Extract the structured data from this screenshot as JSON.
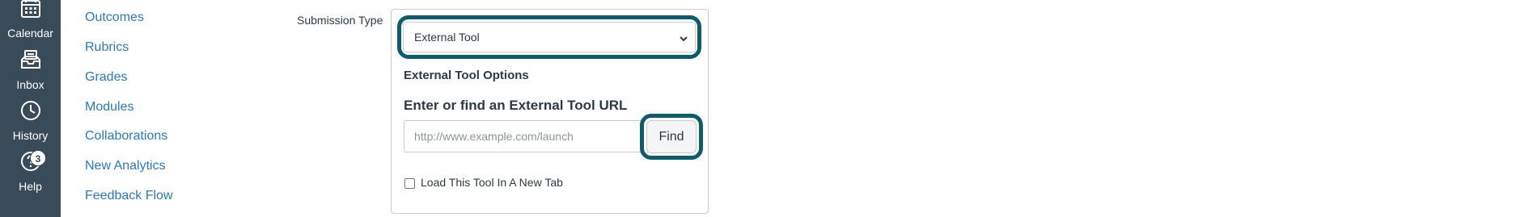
{
  "global_nav": {
    "items": [
      {
        "label": "Calendar",
        "icon": "calendar-icon"
      },
      {
        "label": "Inbox",
        "icon": "inbox-icon"
      },
      {
        "label": "History",
        "icon": "clock-icon"
      },
      {
        "label": "Help",
        "icon": "help-icon",
        "badge": "3"
      }
    ],
    "background": "#394b58"
  },
  "course_nav": {
    "items": [
      "Outcomes",
      "Rubrics",
      "Grades",
      "Modules",
      "Collaborations",
      "New Analytics",
      "Feedback Flow"
    ],
    "link_color": "#2b7abc"
  },
  "form": {
    "submission_type_label": "Submission Type",
    "submission_type_value": "External Tool",
    "external_tool_options_title": "External Tool Options",
    "url_label": "Enter or find an External Tool URL",
    "url_placeholder": "http://www.example.com/launch",
    "find_button_label": "Find",
    "new_tab_checkbox_label": "Load This Tool In A New Tab",
    "new_tab_checked": false,
    "focus_color": "#0b5d6e"
  }
}
